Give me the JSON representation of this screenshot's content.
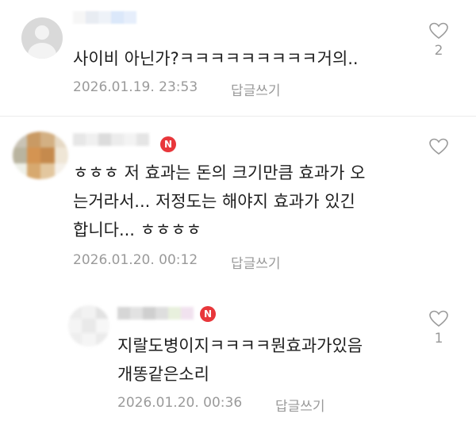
{
  "comments": [
    {
      "text": "사이비 아닌가?ㅋㅋㅋㅋㅋㅋㅋㅋㅋ거의..",
      "date": "2026.01.19. 23:53",
      "reply_label": "답글쓰기",
      "likes": "2"
    },
    {
      "badge": "N",
      "text": "ㅎㅎㅎ 저 효과는 돈의 크기만큼 효과가 오\n는거라서... 저정도는 해야지 효과가 있긴\n합니다... ㅎㅎㅎㅎ",
      "date": "2026.01.20. 00:12",
      "reply_label": "답글쓰기",
      "likes": ""
    },
    {
      "badge": "N",
      "text": "지랄도병이지ㅋㅋㅋㅋ뭔효과가있음\n개똥같은소리",
      "date": "2026.01.20. 00:36",
      "reply_label": "답글쓰기",
      "likes": "1"
    }
  ],
  "icons": {
    "like": "heart-outline-icon",
    "new_badge": "new-badge-icon"
  },
  "colors": {
    "badge": "#e8373b",
    "meta": "#9a9a9a"
  }
}
